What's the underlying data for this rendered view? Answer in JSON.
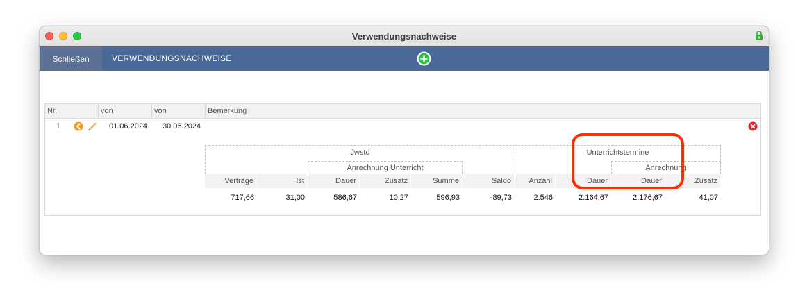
{
  "window": {
    "title": "Verwendungsnachweise"
  },
  "toolbar": {
    "close_label": "Schließen",
    "section_label": "VERWENDUNGSNACHWEISE"
  },
  "table": {
    "headers": [
      "Nr.",
      "von",
      "von",
      "Bemerkung"
    ],
    "row": {
      "nr": "1",
      "von1": "01.06.2024",
      "von2": "30.06.2024",
      "bemerkung": ""
    }
  },
  "summary": {
    "group_jwstd": "Jwstd",
    "group_anrechnung_unterricht": "Anrechnung Unterricht",
    "group_unterrichtstermine": "Unterrichtstermine",
    "group_anrechnung": "Anrechnung",
    "columns": [
      "Verträge",
      "Ist",
      "Dauer",
      "Zusatz",
      "Summe",
      "Saldo",
      "Anzahl",
      "Dauer",
      "Dauer",
      "Zusatz"
    ],
    "values": [
      "717,66",
      "31,00",
      "586,67",
      "10,27",
      "596,93",
      "-89,73",
      "2.546",
      "2.164,67",
      "2.176,67",
      "41,07"
    ]
  },
  "colors": {
    "toolbar": "#486898",
    "highlight": "#ff2d0a",
    "add_green": "#28c83c",
    "delete_red": "#e8232b"
  }
}
